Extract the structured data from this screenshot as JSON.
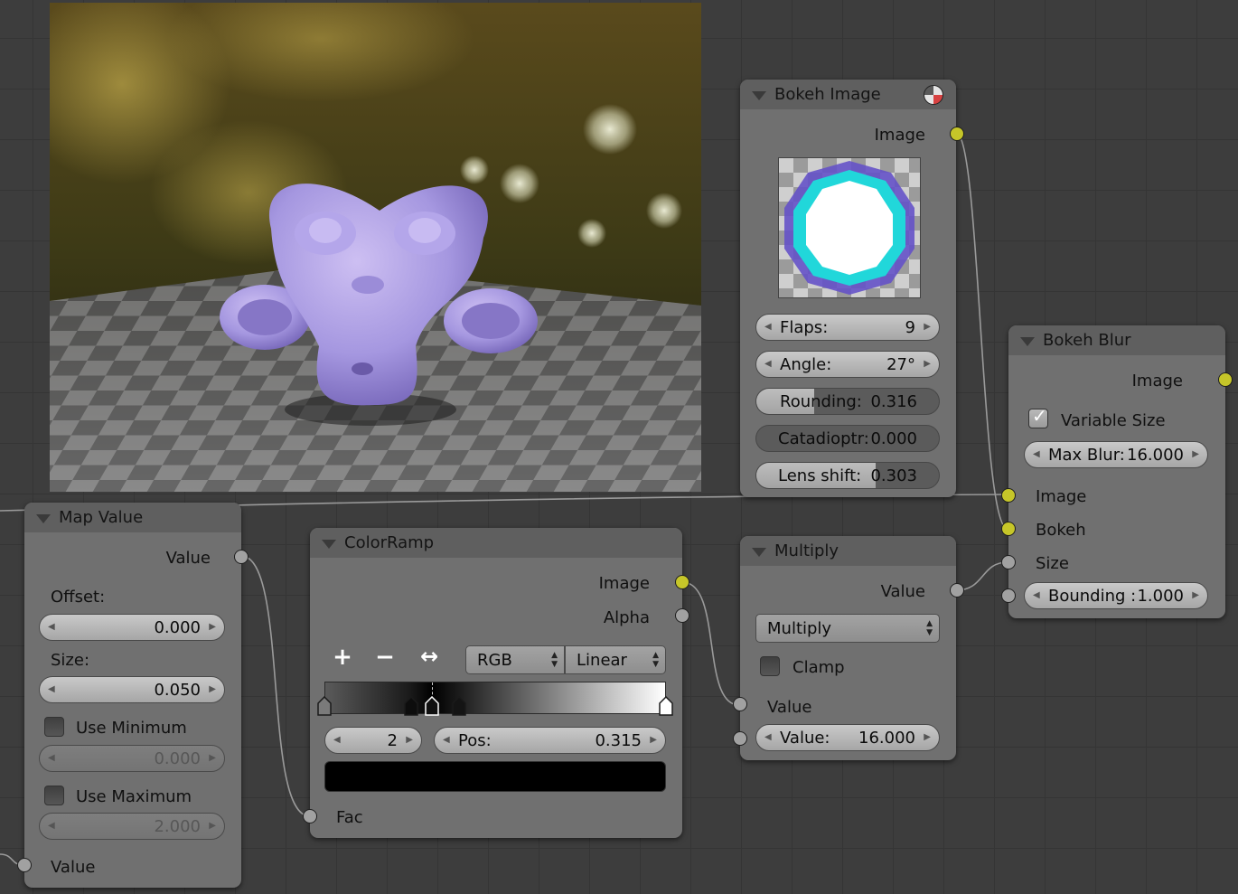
{
  "viewer": {
    "description_icon": "image-viewer"
  },
  "bokeh_image": {
    "title": "Bokeh Image",
    "icon": "render-preview-icon",
    "output_image": "Image",
    "flaps": {
      "label": "Flaps:",
      "value": "9"
    },
    "angle": {
      "label": "Angle:",
      "value": "27°"
    },
    "rounding": {
      "label": "Rounding:",
      "value": "0.316",
      "fraction": 0.316
    },
    "catadioptric": {
      "label": "Catadioptr:",
      "value": "0.000",
      "fraction": 0.0
    },
    "lens_shift": {
      "label": "Lens shift:",
      "value": "0.303",
      "fraction": 0.651
    }
  },
  "bokeh_blur": {
    "title": "Bokeh Blur",
    "output_image": "Image",
    "variable_size": {
      "label": "Variable Size",
      "checked": true
    },
    "max_blur": {
      "label": "Max Blur:",
      "value": "16.000"
    },
    "in_image": "Image",
    "in_bokeh": "Bokeh",
    "in_size": "Size",
    "bounding": {
      "label": "Bounding :",
      "value": "1.000"
    }
  },
  "map_value": {
    "title": "Map Value",
    "output_value": "Value",
    "offset_label": "Offset:",
    "offset_value": "0.000",
    "size_label": "Size:",
    "size_value": "0.050",
    "use_minimum": {
      "label": "Use Minimum",
      "checked": false,
      "value": "0.000"
    },
    "use_maximum": {
      "label": "Use Maximum",
      "checked": false,
      "value": "2.000"
    },
    "input_value": "Value"
  },
  "color_ramp": {
    "title": "ColorRamp",
    "output_image": "Image",
    "output_alpha": "Alpha",
    "add": "+",
    "remove": "−",
    "flip": "↔",
    "color_mode": "RGB",
    "interpolation": "Linear",
    "active_index": "2",
    "pos_label": "Pos:",
    "pos_value": "0.315",
    "active_color": "#000000",
    "stops": [
      0.0,
      0.255,
      0.315,
      0.395,
      1.0
    ],
    "input_fac": "Fac"
  },
  "multiply": {
    "title": "Multiply",
    "output_value": "Value",
    "operation": "Multiply",
    "clamp": {
      "label": "Clamp",
      "checked": false
    },
    "in_value1": "Value",
    "value2": {
      "label": "Value:",
      "value": "16.000"
    }
  },
  "colors": {
    "socket_image": "#c6c629",
    "socket_value": "#a1a1a1",
    "node_body": "#707070",
    "node_header": "#5f5f5f"
  }
}
